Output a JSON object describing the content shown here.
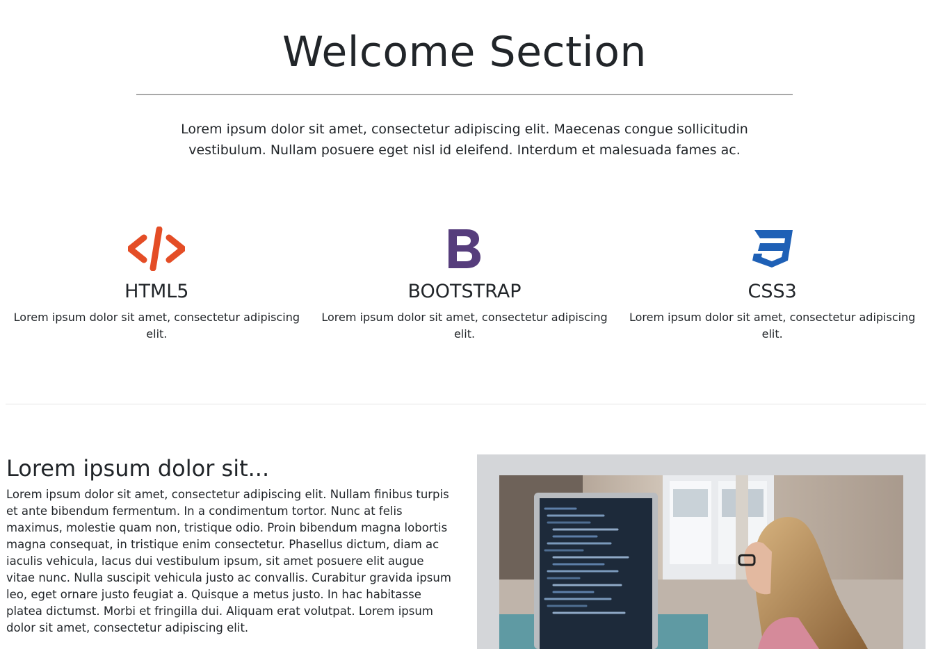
{
  "welcome": {
    "title": "Welcome Section",
    "intro": "Lorem ipsum dolor sit amet, consectetur adipiscing elit. Maecenas congue sollicitudin vestibulum. Nullam posuere eget nisl id eleifend. Interdum et malesuada fames ac."
  },
  "features": [
    {
      "icon": "html5-code-icon",
      "color": "#e44d26",
      "title": "HTML5",
      "text": "Lorem ipsum dolor sit amet, consectetur adipiscing elit."
    },
    {
      "icon": "bootstrap-b-icon",
      "color": "#563d7c",
      "title": "BOOTSTRAP",
      "text": "Lorem ipsum dolor sit amet, consectetur adipiscing elit."
    },
    {
      "icon": "css3-shield-icon",
      "color": "#1e60b6",
      "title": "CSS3",
      "text": "Lorem ipsum dolor sit amet, consectetur adipiscing elit."
    }
  ],
  "about": {
    "title": "Lorem ipsum dolor sit...",
    "body": "Lorem ipsum dolor sit amet, consectetur adipiscing elit. Nullam finibus turpis et ante bibendum fermentum. In a condimentum tortor. Nunc at felis maximus, molestie quam non, tristique odio. Proin bibendum magna lobortis magna consequat, in tristique enim consectetur. Phasellus dictum, diam ac iaculis vehicula, lacus dui vestibulum ipsum, sit amet posuere elit augue vitae nunc. Nulla suscipit vehicula justo ac convallis. Curabitur gravida ipsum leo, eget ornare justo feugiat a. Quisque a metus justo. In hac habitasse platea dictumst. Morbi et fringilla dui. Aliquam erat volutpat. Lorem ipsum dolor sit amet, consectetur adipiscing elit."
  },
  "colors": {
    "text": "#212529",
    "html5": "#e44d26",
    "bootstrap": "#563d7c",
    "css3": "#1e60b6",
    "media_frame": "#d4d6d9"
  }
}
